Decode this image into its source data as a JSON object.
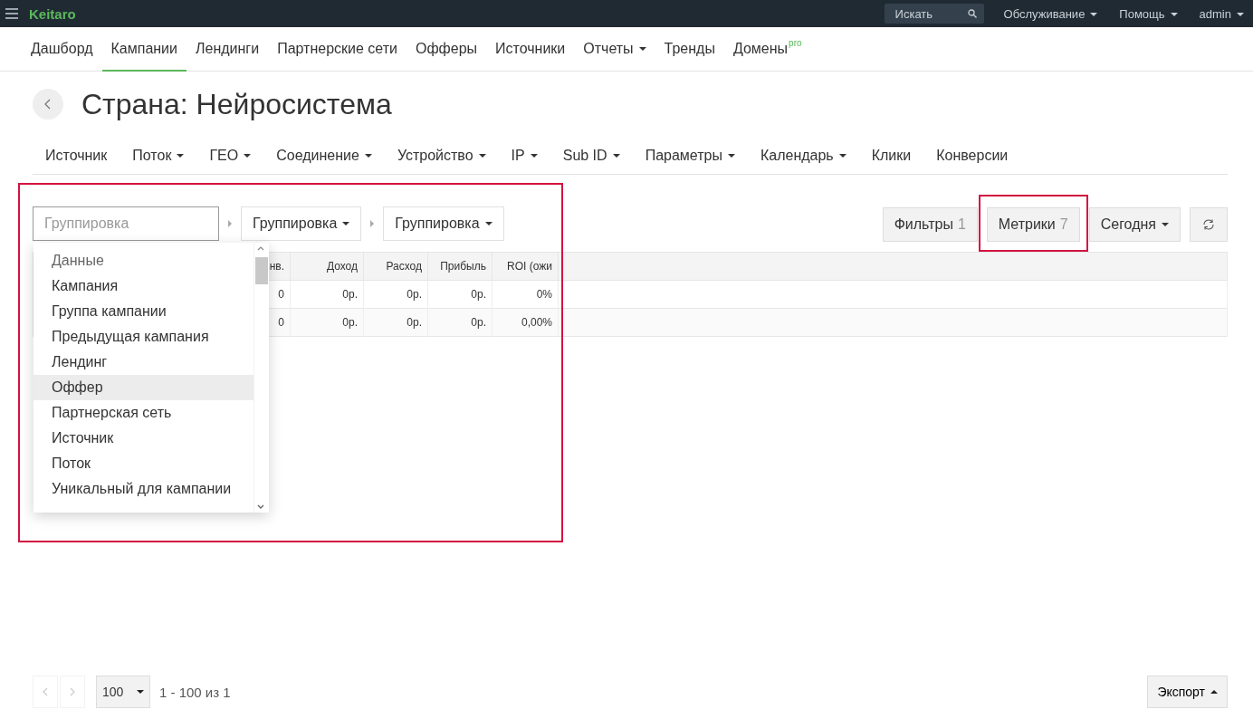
{
  "topbar": {
    "logo": "Keitaro",
    "search": {
      "placeholder": "Искать"
    },
    "menus": [
      "Обслуживание",
      "Помощь",
      "admin"
    ]
  },
  "nav": {
    "items": [
      {
        "label": "Дашборд",
        "selected": false,
        "dropdown": false
      },
      {
        "label": "Кампании",
        "selected": true,
        "dropdown": false
      },
      {
        "label": "Лендинги",
        "selected": false,
        "dropdown": false
      },
      {
        "label": "Партнерские сети",
        "selected": false,
        "dropdown": false
      },
      {
        "label": "Офферы",
        "selected": false,
        "dropdown": false
      },
      {
        "label": "Источники",
        "selected": false,
        "dropdown": false
      },
      {
        "label": "Отчеты",
        "selected": false,
        "dropdown": true
      },
      {
        "label": "Тренды",
        "selected": false,
        "dropdown": false
      },
      {
        "label": "Домены",
        "selected": false,
        "dropdown": false,
        "badge": "pro"
      }
    ]
  },
  "title": "Страна: Нейросистема",
  "report_tabs": [
    {
      "label": "Источник",
      "dropdown": false
    },
    {
      "label": "Поток",
      "dropdown": true
    },
    {
      "label": "ГЕО",
      "dropdown": true
    },
    {
      "label": "Соединение",
      "dropdown": true
    },
    {
      "label": "Устройство",
      "dropdown": true
    },
    {
      "label": "IP",
      "dropdown": true
    },
    {
      "label": "Sub ID",
      "dropdown": true
    },
    {
      "label": "Параметры",
      "dropdown": true
    },
    {
      "label": "Календарь",
      "dropdown": true
    },
    {
      "label": "Клики",
      "dropdown": false
    },
    {
      "label": "Конверсии",
      "dropdown": false
    }
  ],
  "grouping": {
    "highlighted": true,
    "input": {
      "placeholder": "Группировка"
    },
    "levels": [
      "Группировка",
      "Группировка"
    ],
    "menu": {
      "items": [
        {
          "label": "Данные",
          "kind": "header",
          "selected": false
        },
        {
          "label": "Кампания",
          "kind": "option",
          "selected": false
        },
        {
          "label": "Группа кампании",
          "kind": "option",
          "selected": false
        },
        {
          "label": "Предыдущая кампания",
          "kind": "option",
          "selected": false
        },
        {
          "label": "Лендинг",
          "kind": "option",
          "selected": false
        },
        {
          "label": "Оффер",
          "kind": "option",
          "selected": true
        },
        {
          "label": "Партнерская сеть",
          "kind": "option",
          "selected": false
        },
        {
          "label": "Источник",
          "kind": "option",
          "selected": false
        },
        {
          "label": "Поток",
          "kind": "option",
          "selected": false
        },
        {
          "label": "Уникальный для кампании",
          "kind": "option",
          "selected": false
        }
      ]
    }
  },
  "toolbar_buttons": [
    {
      "kind": "counter",
      "label": "Фильтры",
      "count": "1",
      "highlighted": false
    },
    {
      "kind": "counter",
      "label": "Метрики",
      "count": "7",
      "highlighted": true
    },
    {
      "kind": "dropdown",
      "label": "Сегодня",
      "highlighted": false
    },
    {
      "kind": "refresh",
      "highlighted": false
    }
  ],
  "table": {
    "columns": [
      "нв.",
      "Доход",
      "Расход",
      "Прибыль",
      "ROI (ожи"
    ],
    "rows": [
      [
        "0",
        "0р.",
        "0р.",
        "0р.",
        "0%"
      ],
      [
        "0",
        "0р.",
        "0р.",
        "0р.",
        "0,00%"
      ]
    ]
  },
  "pager": {
    "prev": {
      "disabled": true
    },
    "next": {
      "disabled": true
    },
    "page_size": "100",
    "range": "1 - 100 из 1",
    "export": "Экспорт"
  }
}
